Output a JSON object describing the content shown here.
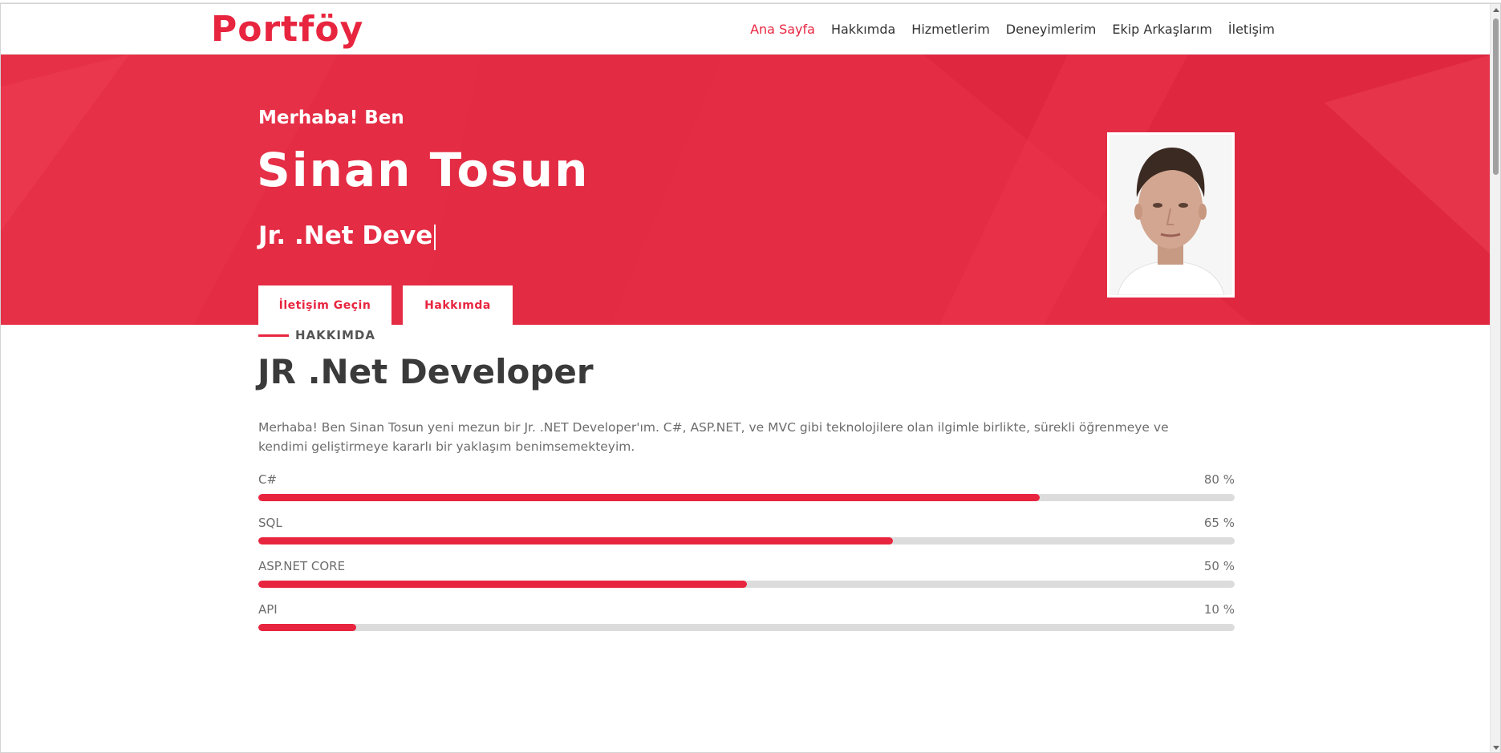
{
  "brand": {
    "name": "Portföy",
    "color": "#e8253f"
  },
  "nav": {
    "items": [
      {
        "label": "Ana Sayfa",
        "active": true
      },
      {
        "label": "Hakkımda",
        "active": false
      },
      {
        "label": "Hizmetlerim",
        "active": false
      },
      {
        "label": "Deneyimlerim",
        "active": false
      },
      {
        "label": "Ekip Arkaşlarım",
        "active": false
      },
      {
        "label": "İletişim",
        "active": false
      }
    ]
  },
  "hero": {
    "greeting": "Merhaba! Ben",
    "name": "Sinan Tosun",
    "role_typed": "Jr. .Net Deve",
    "buttons": {
      "contact": "İletişim Geçin",
      "about": "Hakkımda"
    },
    "background_color": "#e42c44"
  },
  "about": {
    "kicker": "HAKKIMDA",
    "title": "JR .Net Developer",
    "description": "Merhaba! Ben Sinan Tosun yeni mezun bir Jr. .NET Developer'ım. C#, ASP.NET, ve MVC gibi teknolojilere olan ilgimle birlikte, sürekli öğrenmeye ve kendimi geliştirmeye kararlı bir yaklaşım benimsemekteyim.",
    "skills": [
      {
        "name": "C#",
        "percent_label": "80 %",
        "level": 0.8
      },
      {
        "name": "SQL",
        "percent_label": "65 %",
        "level": 0.65
      },
      {
        "name": "ASP.NET CORE",
        "percent_label": "50 %",
        "level": 0.5
      },
      {
        "name": "API",
        "percent_label": "10 %",
        "level": 0.1
      }
    ]
  },
  "icons": {
    "avatar": "profile-photo"
  }
}
